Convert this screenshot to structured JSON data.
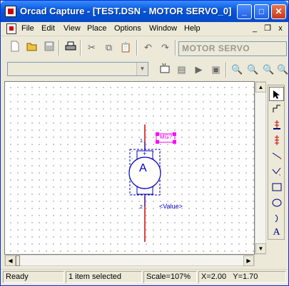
{
  "window": {
    "title": "Orcad Capture - [TEST.DSN - MOTOR SERVO_0]",
    "controls": {
      "minimize": "_",
      "maximize": "□",
      "close": "✕"
    }
  },
  "menu": {
    "items": [
      "File",
      "Edit",
      "View",
      "Place",
      "Options",
      "Window",
      "Help"
    ],
    "mdi_controls": {
      "minimize": "_",
      "restore": "❐",
      "close": "x"
    }
  },
  "toolbar": {
    "part_name": "MOTOR SERVO",
    "combo_value": ""
  },
  "schematic": {
    "part_reference": "MG?",
    "motor_label": "A",
    "plus_pin": "+",
    "minus_pin": "-",
    "pin_top": "1",
    "pin_bottom": "2",
    "value_text": "<Value>",
    "colors": {
      "wire": "#d40000",
      "part": "#0000c0",
      "selected": "#ff00ff"
    }
  },
  "palette": {
    "tools": [
      "select-arrow-icon",
      "wire-icon",
      "net-alias-icon",
      "bus-icon",
      "line-icon",
      "polyline-icon",
      "rectangle-icon",
      "ellipse-icon",
      "arc-icon",
      "text-icon"
    ],
    "text_glyph": "A"
  },
  "status": {
    "state": "Ready",
    "selection": "1 item selected",
    "scale": "Scale=107%",
    "x": "X=2.00",
    "y": "Y=1.70"
  }
}
